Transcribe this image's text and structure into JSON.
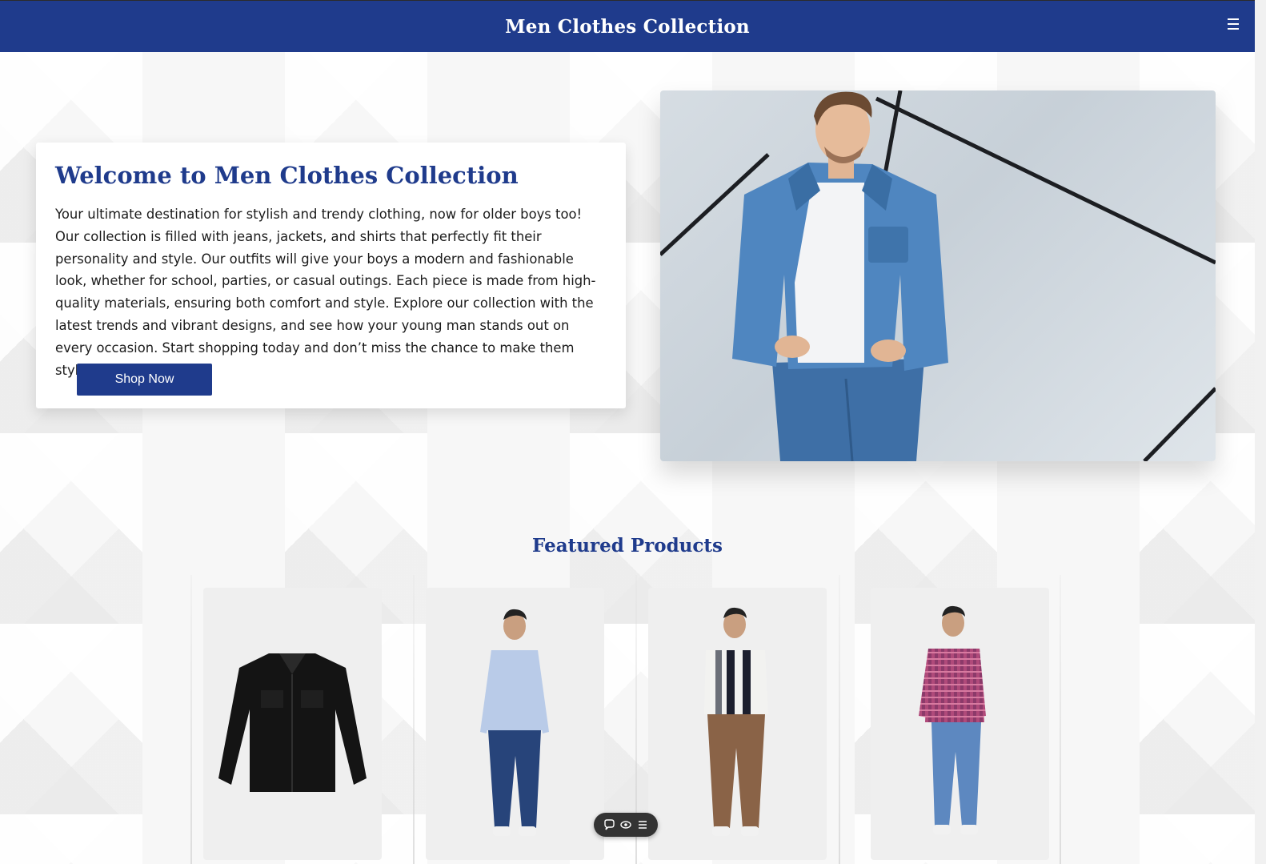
{
  "header": {
    "title": "Men Clothes Collection",
    "menu_icon": "hamburger-menu-icon"
  },
  "hero": {
    "heading": "Welcome to Men Clothes Collection",
    "description": "Your ultimate destination for stylish and trendy clothing, now for older boys too! Our collection is filled with jeans, jackets, and shirts that perfectly fit their personality and style. Our outfits will give your boys a modern and fashionable look, whether for school, parties, or casual outings. Each piece is made from high-quality materials, ensuring both comfort and style. Explore our collection with the latest trends and vibrant designs, and see how your young man stands out on every occasion. Start shopping today and don’t miss the chance to make them stylish!",
    "button_label": "Shop Now"
  },
  "featured": {
    "title": "Featured Products"
  },
  "products": [
    {
      "item": "black denim jacket"
    },
    {
      "item": "man in light blue shirt and dark jeans"
    },
    {
      "item": "man in striped polo and brown trousers"
    },
    {
      "item": "man in pink checked shirt and blue jeans"
    }
  ],
  "toolbar": {
    "icons": [
      "chat-bubble-icon",
      "eye-icon",
      "list-icon"
    ]
  },
  "colors": {
    "brand": "#1f3b8c",
    "card_bg": "#ffffff",
    "text": "#1b1b1b"
  }
}
